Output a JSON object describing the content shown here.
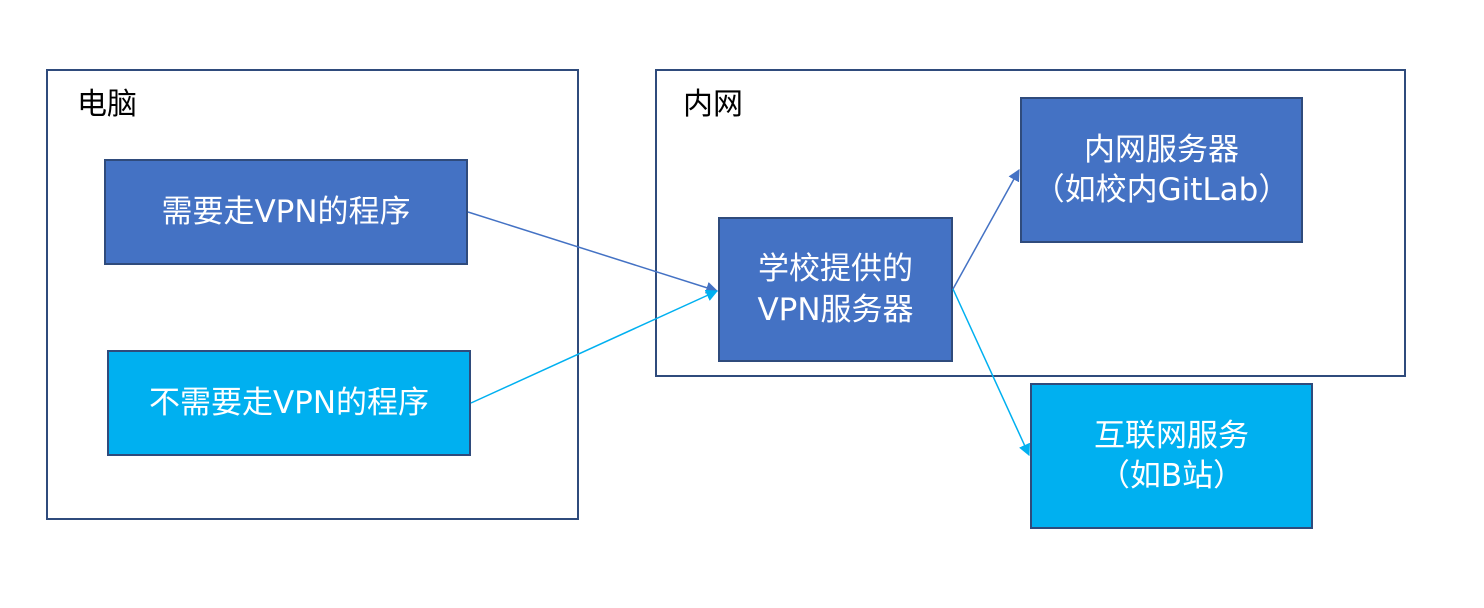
{
  "computer": {
    "label": "电脑",
    "vpn_program": "需要走VPN的程序",
    "non_vpn_program": "不需要走VPN的程序"
  },
  "intranet": {
    "label": "内网",
    "school_vpn": {
      "line1": "学校提供的",
      "line2": "VPN服务器"
    },
    "intranet_server": {
      "line1": "内网服务器",
      "line2": "（如校内GitLab）"
    }
  },
  "internet_service": {
    "line1": "互联网服务",
    "line2": "（如B站）"
  },
  "colors": {
    "dark_node": "#4472c4",
    "light_node": "#00b0f0",
    "border": "#2f4b7c"
  }
}
